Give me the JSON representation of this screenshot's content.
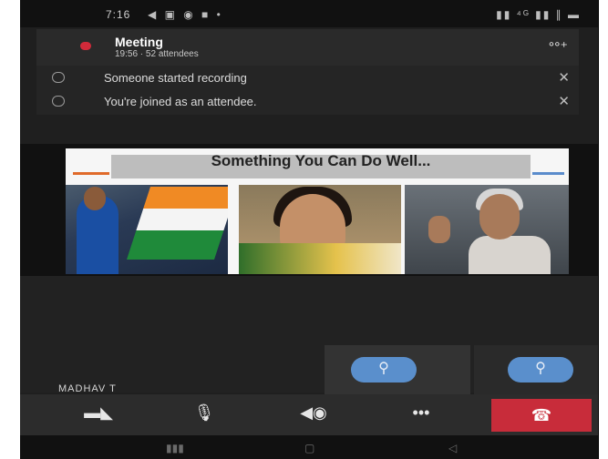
{
  "status_bar": {
    "time": "7:16",
    "left_icons": "◀ ▣ ◉ ■ •",
    "right_icons": "▮▮ ⁴ᴳ ▮▮ ∥ ▬"
  },
  "meeting": {
    "title": "Meeting",
    "subtitle": "19:56 · 52 attendees",
    "people_icon": "people-icon",
    "people_glyph": "°°⁺"
  },
  "notifications": [
    {
      "text": "Someone started recording",
      "close": "✕"
    },
    {
      "text": "You're joined as an attendee.",
      "close": "✕"
    }
  ],
  "shared_slide": {
    "title": "Something You Can Do Well..."
  },
  "participants": {
    "self_name": "MADHAV T"
  },
  "controls": {
    "video_off": "▬◣",
    "mic_off": "🎙",
    "speaker": "◀◉",
    "more": "•••",
    "hang_up": "☎"
  },
  "colors": {
    "accent_blue": "#5a8fcc",
    "hangup_red": "#c82c3a",
    "record_red": "#d12a3a"
  }
}
